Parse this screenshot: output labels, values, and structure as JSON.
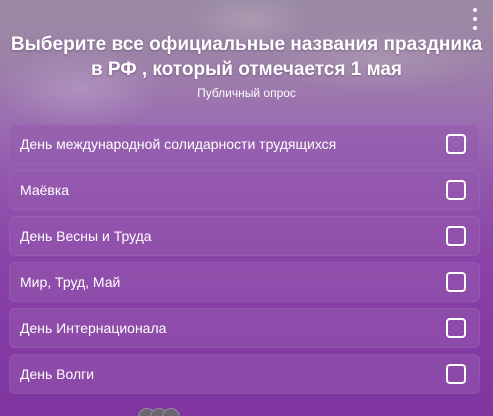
{
  "poll": {
    "title": "Выберите все официальные названия праздника в РФ , который отмечается 1 мая",
    "subtitle": "Публичный опрос",
    "options": [
      {
        "label": "День международной солидарности трудящихся"
      },
      {
        "label": "Маёвка"
      },
      {
        "label": "День Весны и Труда"
      },
      {
        "label": "Мир, Труд, Май"
      },
      {
        "label": "День Интернационала"
      },
      {
        "label": "День Волги"
      }
    ]
  },
  "icons": {
    "menu": "more-vertical-icon",
    "checkbox": "checkbox-empty-icon"
  },
  "colors": {
    "text": "#ffffff",
    "option_background": "#9a5ab4",
    "page_background": "#8a43a8"
  }
}
